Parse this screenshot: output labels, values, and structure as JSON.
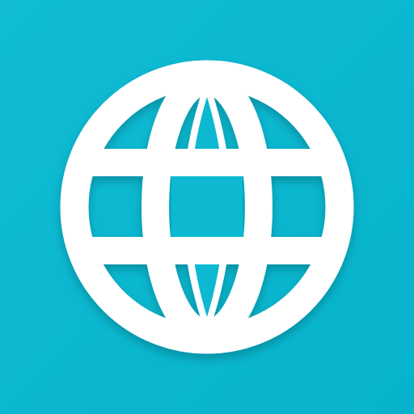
{
  "icon": {
    "name": "globe-icon",
    "background_color": "#0FBCD4",
    "background_color_dark": "#06B3CB",
    "foreground_color": "#FFFFFF"
  }
}
